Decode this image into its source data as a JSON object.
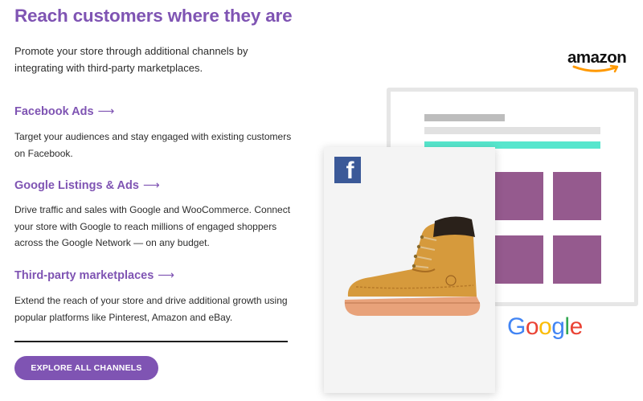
{
  "header": {
    "title": "Reach customers where they are",
    "intro": "Promote your store through additional channels by integrating with third-party marketplaces."
  },
  "sections": [
    {
      "link": "Facebook Ads",
      "arrow": "⟶",
      "text": "Target your audiences and stay engaged with existing customers on Facebook."
    },
    {
      "link": "Google Listings & Ads",
      "arrow": "⟶",
      "text": "Drive traffic and sales with Google and WooCommerce. Connect your store with Google to reach millions of engaged shoppers across the Google Network — on any budget."
    },
    {
      "link": "Third-party marketplaces",
      "arrow": "⟶",
      "text": "Extend the reach of your store and drive additional growth using popular platforms like Pinterest, Amazon and eBay."
    }
  ],
  "cta": {
    "label": "EXPLORE ALL CHANNELS"
  },
  "illustration": {
    "amazon_text": "amazon",
    "facebook_letter": "f",
    "google": {
      "g": "G",
      "o1": "o",
      "o2": "o",
      "g2": "g",
      "l": "l",
      "e": "e"
    },
    "icons": [
      "facebook-icon",
      "amazon-logo",
      "google-logo",
      "boot-image"
    ]
  },
  "colors": {
    "brand_purple": "#7f54b3",
    "tile_purple": "#955a8e",
    "teal_bar": "#57e6cd",
    "facebook_blue": "#3b5998"
  }
}
